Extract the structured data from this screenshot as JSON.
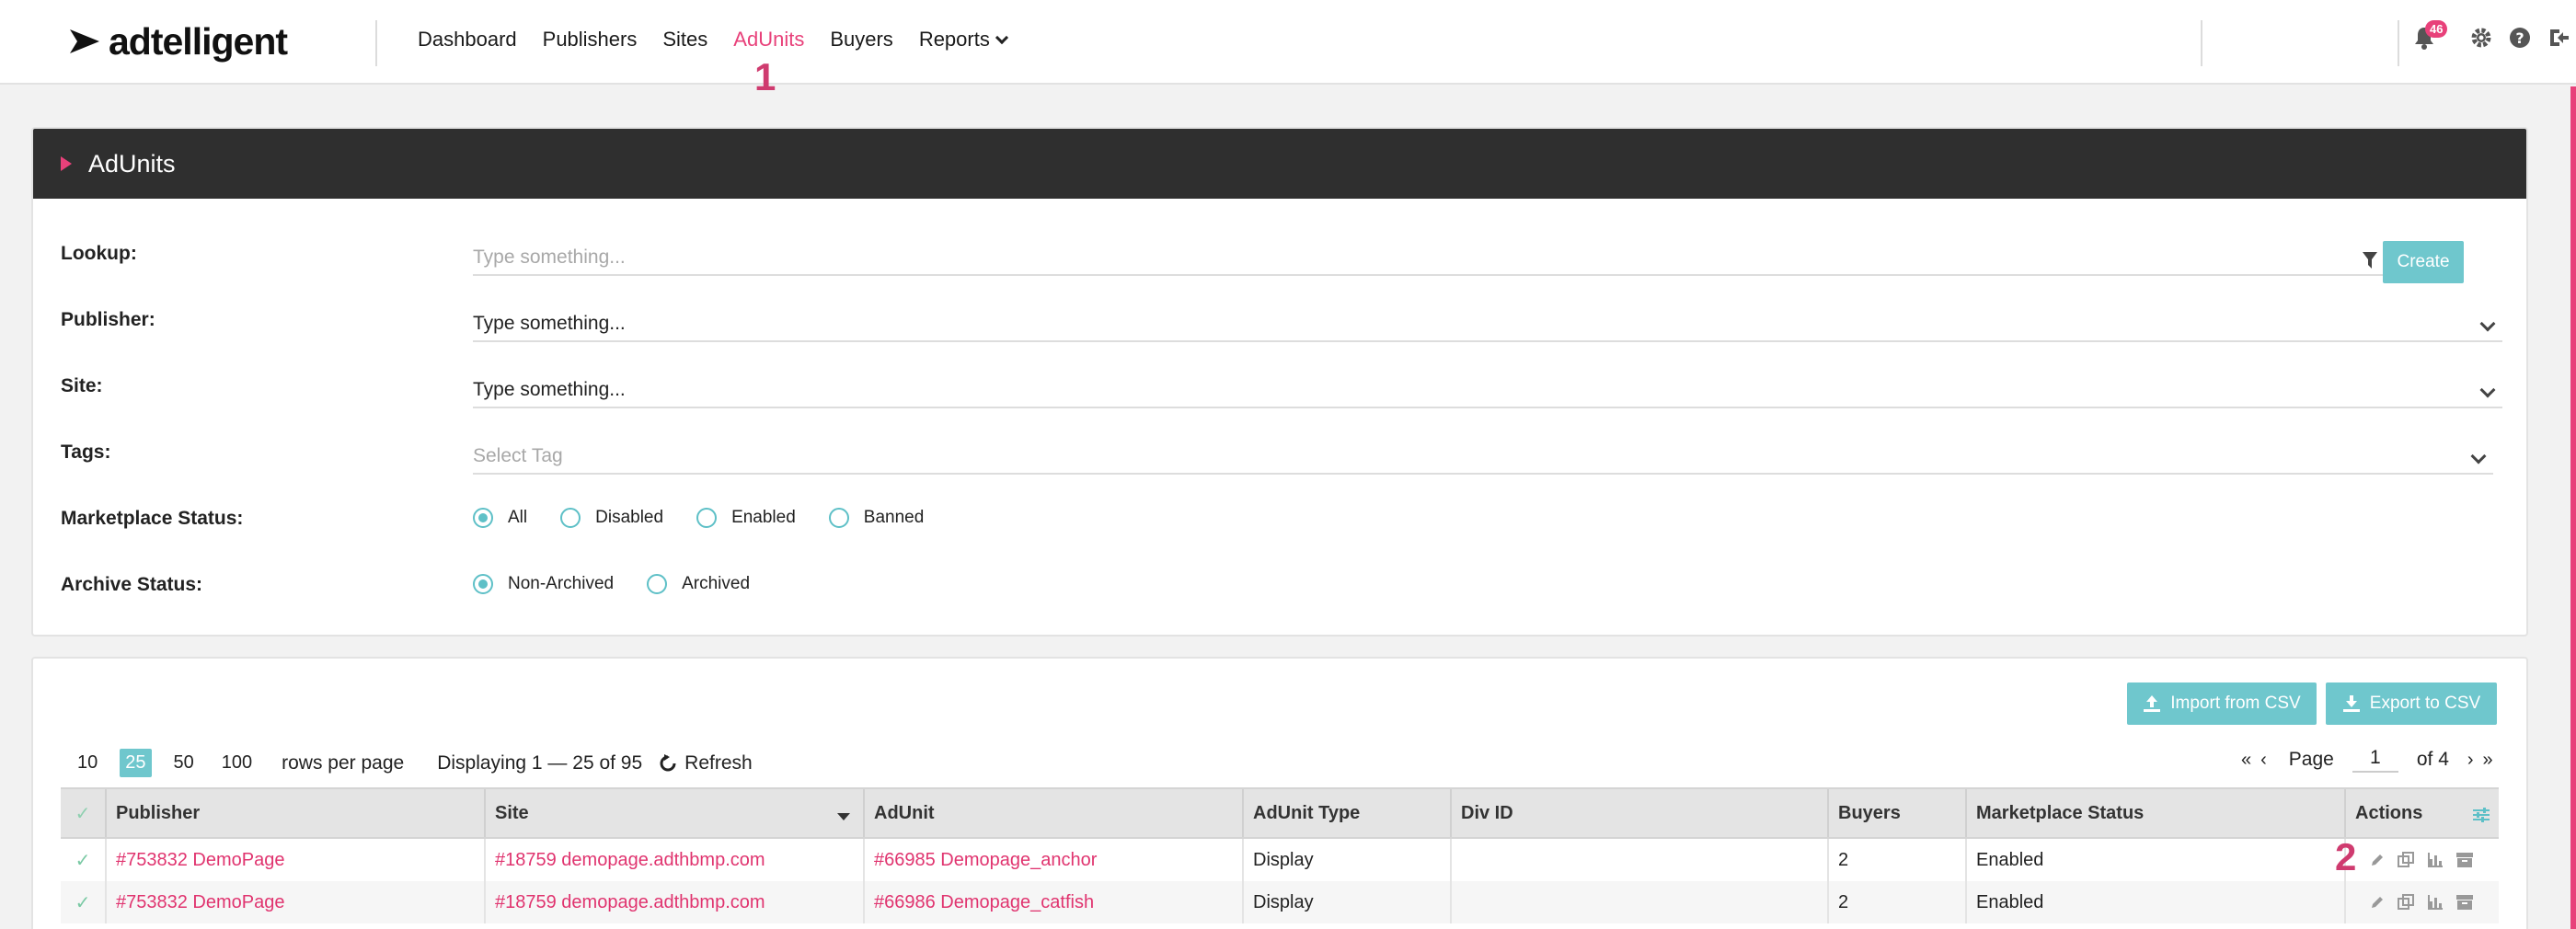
{
  "brand": {
    "name": "adtelligent",
    "accent": "#e8417a",
    "teal": "#6fc7cd",
    "header_dark": "#2f2f2f"
  },
  "nav": {
    "items": [
      {
        "label": "Dashboard",
        "active": false
      },
      {
        "label": "Publishers",
        "active": false
      },
      {
        "label": "Sites",
        "active": false
      },
      {
        "label": "AdUnits",
        "active": true
      },
      {
        "label": "Buyers",
        "active": false
      },
      {
        "label": "Reports",
        "active": false
      }
    ],
    "notification_count": "46",
    "icons": [
      "bell-icon",
      "gear-icon",
      "help-icon",
      "logout-icon"
    ]
  },
  "markers": {
    "m1": "1",
    "m2": "2"
  },
  "panel": {
    "title": "AdUnits",
    "lookup": {
      "label": "Lookup:",
      "placeholder": "Type something..."
    },
    "publisher": {
      "label": "Publisher:",
      "value": "Type something..."
    },
    "site": {
      "label": "Site:",
      "value": "Type something..."
    },
    "tags": {
      "label": "Tags:",
      "placeholder": "Select Tag"
    },
    "create_label": "Create",
    "marketplace": {
      "label": "Marketplace Status:",
      "options": [
        "All",
        "Disabled",
        "Enabled",
        "Banned"
      ],
      "selected": "All"
    },
    "archive": {
      "label": "Archive Status:",
      "options": [
        "Non-Archived",
        "Archived"
      ],
      "selected": "Non-Archived"
    }
  },
  "table_panel": {
    "import_label": "Import from CSV",
    "export_label": "Export to CSV",
    "rows_per_page_options": [
      "10",
      "25",
      "50",
      "100"
    ],
    "rows_per_page_selected": "25",
    "rows_per_page_text": "rows per page",
    "displaying": "Displaying 1 — 25 of 95",
    "refresh_label": "Refresh",
    "page_label": "Page",
    "page_value": "1",
    "page_of": "of 4",
    "columns": [
      "Publisher",
      "Site",
      "AdUnit",
      "AdUnit Type",
      "Div ID",
      "Buyers",
      "Marketplace Status",
      "Actions"
    ],
    "rows": [
      {
        "publisher": "#753832 DemoPage",
        "site": "#18759 demopage.adthbmp.com",
        "adunit": "#66985 Demopage_anchor",
        "type": "Display",
        "divid": "",
        "buyers": "2",
        "status": "Enabled"
      },
      {
        "publisher": "#753832 DemoPage",
        "site": "#18759 demopage.adthbmp.com",
        "adunit": "#66986 Demopage_catfish",
        "type": "Display",
        "divid": "",
        "buyers": "2",
        "status": "Enabled"
      }
    ]
  }
}
